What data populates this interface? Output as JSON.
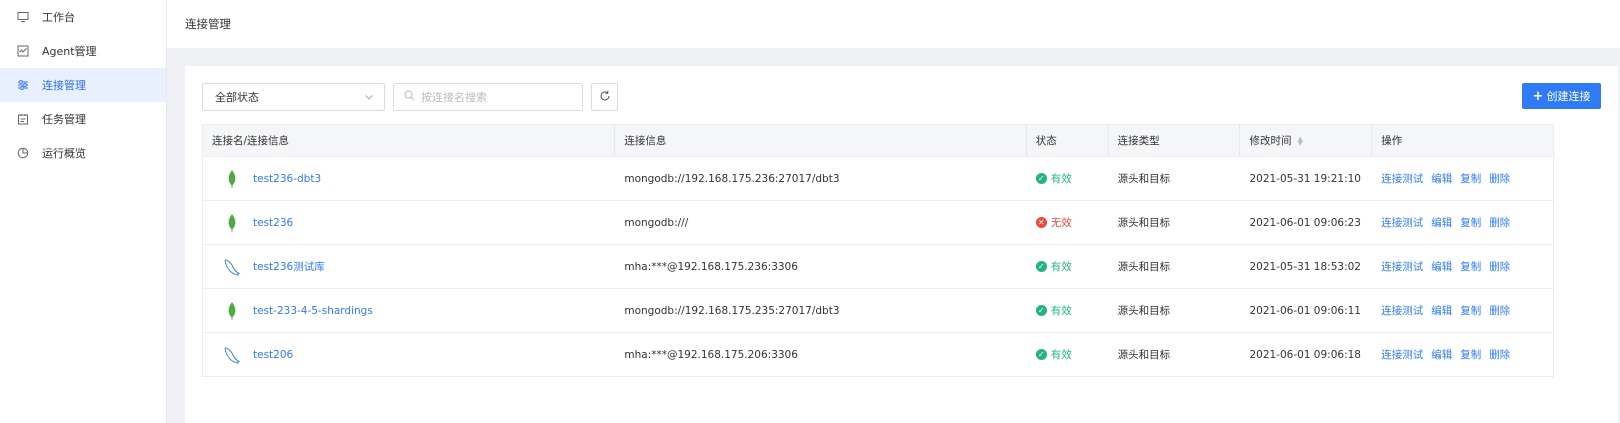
{
  "sidebar": {
    "items": [
      {
        "label": "工作台",
        "icon": "monitor-icon",
        "active": false
      },
      {
        "label": "Agent管理",
        "icon": "agent-icon",
        "active": false
      },
      {
        "label": "连接管理",
        "icon": "sliders-icon",
        "active": true
      },
      {
        "label": "任务管理",
        "icon": "calendar-icon",
        "active": false
      },
      {
        "label": "运行概览",
        "icon": "pie-chart-icon",
        "active": false
      }
    ]
  },
  "header": {
    "title": "连接管理"
  },
  "toolbar": {
    "status_select": "全部状态",
    "search_placeholder": "按连接名搜索",
    "create_label": "创建连接"
  },
  "table": {
    "columns": [
      "连接名/连接信息",
      "连接信息",
      "状态",
      "连接类型",
      "修改时间",
      "操作"
    ],
    "rows": [
      {
        "icon": "mongodb-icon",
        "name": "test236-dbt3",
        "info": "mongodb://192.168.175.236:27017/dbt3",
        "status": "有效",
        "valid": true,
        "type": "源头和目标",
        "time": "2021-05-31 19:21:10"
      },
      {
        "icon": "mongodb-icon",
        "name": "test236",
        "info": "mongodb:///",
        "status": "无效",
        "valid": false,
        "type": "源头和目标",
        "time": "2021-06-01 09:06:23"
      },
      {
        "icon": "mysql-icon",
        "name": "test236测试库",
        "info": "mha:***@192.168.175.236:3306",
        "status": "有效",
        "valid": true,
        "type": "源头和目标",
        "time": "2021-05-31 18:53:02"
      },
      {
        "icon": "mongodb-icon",
        "name": "test-233-4-5-shardings",
        "info": "mongodb://192.168.175.235:27017/dbt3",
        "status": "有效",
        "valid": true,
        "type": "源头和目标",
        "time": "2021-06-01 09:06:11"
      },
      {
        "icon": "mysql-icon",
        "name": "test206",
        "info": "mha:***@192.168.175.206:3306",
        "status": "有效",
        "valid": true,
        "type": "源头和目标",
        "time": "2021-06-01 09:06:18"
      }
    ],
    "actions": [
      "连接测试",
      "编辑",
      "复制",
      "删除"
    ]
  },
  "colors": {
    "accent": "#2f7bf5",
    "valid": "#24b47e",
    "invalid": "#f0483e",
    "mongodb": "#4faa41",
    "mysql": "#4a8ac4"
  }
}
